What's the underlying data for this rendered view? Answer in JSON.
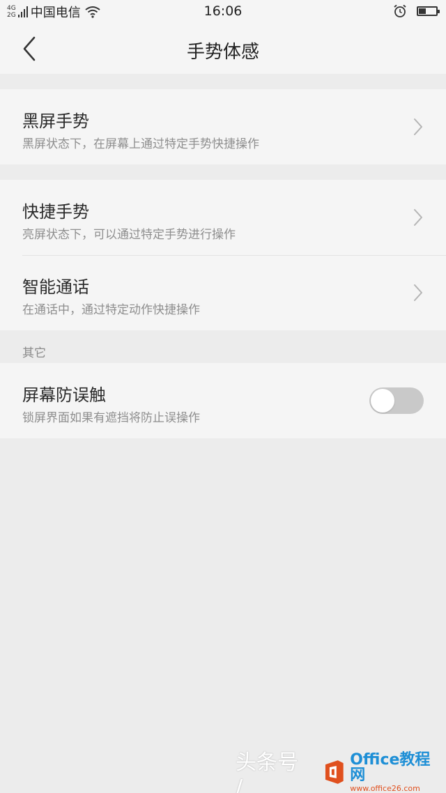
{
  "status_bar": {
    "net_top": "4G",
    "net_bottom": "2G",
    "carrier": "中国电信",
    "time": "16:06",
    "battery_level": 0.4
  },
  "header": {
    "title": "手势体感"
  },
  "sections": [
    {
      "items": [
        {
          "title": "黑屏手势",
          "subtitle": "黑屏状态下，在屏幕上通过特定手势快捷操作"
        }
      ]
    },
    {
      "items": [
        {
          "title": "快捷手势",
          "subtitle": "亮屏状态下，可以通过特定手势进行操作"
        },
        {
          "title": "智能通话",
          "subtitle": "在通话中，通过特定动作快捷操作"
        }
      ]
    },
    {
      "header": "其它",
      "items": [
        {
          "title": "屏幕防误触",
          "subtitle": "锁屏界面如果有遮挡将防止误操作",
          "toggle_on": false
        }
      ]
    }
  ],
  "watermark": {
    "text": "头条号 / ",
    "brand": "Office教程网",
    "url": "www.office26.com"
  },
  "colors": {
    "background": "#ececec",
    "card": "#f5f5f5",
    "toggle_off": "#c9c9c9",
    "brand_blue": "#1e8fd6",
    "brand_orange": "#e0501e"
  },
  "icons": [
    "back-arrow-icon",
    "chevron-right-icon",
    "wifi-icon",
    "alarm-icon",
    "battery-icon",
    "signal-icon",
    "office-logo-icon"
  ]
}
